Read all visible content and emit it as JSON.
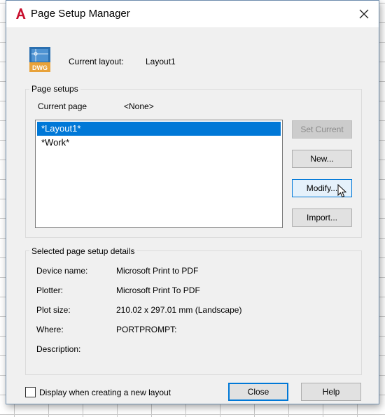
{
  "window": {
    "title": "Page Setup Manager",
    "app_icon": "autocad-a-icon",
    "close_icon": "close-icon"
  },
  "current_layout": {
    "label": "Current layout:",
    "value": "Layout1",
    "icon": "dwg-file-icon",
    "icon_text": "DWG"
  },
  "page_setups": {
    "group_title": "Page setups",
    "current_page_label": "Current page",
    "current_page_value": "<None>",
    "items": [
      {
        "label": "*Layout1*",
        "selected": true
      },
      {
        "label": "*Work*",
        "selected": false
      }
    ],
    "buttons": {
      "set_current": "Set Current",
      "new": "New...",
      "modify": "Modify...",
      "import": "Import..."
    }
  },
  "details": {
    "group_title": "Selected page setup details",
    "rows": [
      {
        "label": "Device name:",
        "value": "Microsoft Print to PDF"
      },
      {
        "label": "Plotter:",
        "value": "Microsoft Print To PDF"
      },
      {
        "label": "Plot size:",
        "value": "210.02 x 297.01 mm (Landscape)"
      },
      {
        "label": "Where:",
        "value": "PORTPROMPT:"
      },
      {
        "label": "Description:",
        "value": ""
      }
    ]
  },
  "footer": {
    "checkbox_label": "Display when creating a new layout",
    "checkbox_checked": false,
    "close_label": "Close",
    "help_label": "Help"
  },
  "colors": {
    "selection": "#0078d7",
    "dialog_bg": "#f0f0f0",
    "accent_red": "#c8102e"
  }
}
